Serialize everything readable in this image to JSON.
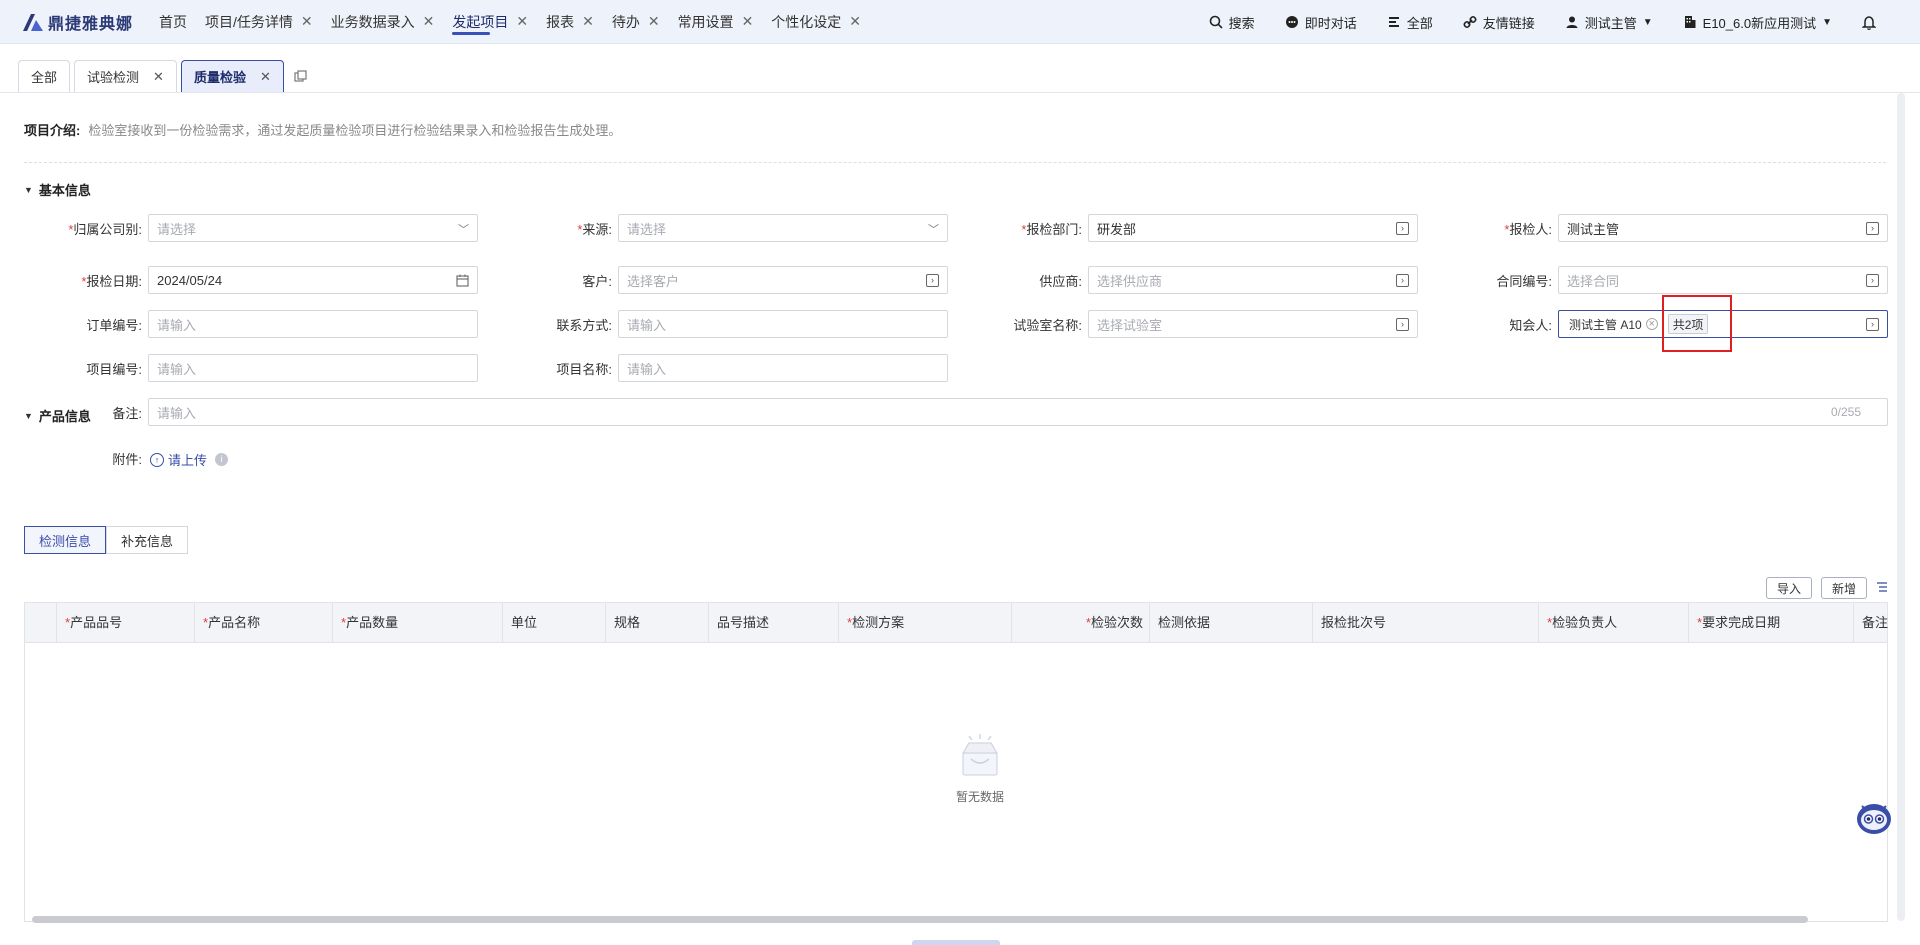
{
  "brand": {
    "name": "鼎捷雅典娜",
    "accent": "#3a4ea8"
  },
  "nav": {
    "items": [
      {
        "label": "首页",
        "closable": false
      },
      {
        "label": "项目/任务详情",
        "closable": true
      },
      {
        "label": "业务数据录入",
        "closable": true
      },
      {
        "label": "发起项目",
        "closable": true,
        "active": true
      },
      {
        "label": "报表",
        "closable": true
      },
      {
        "label": "待办",
        "closable": true
      },
      {
        "label": "常用设置",
        "closable": true
      },
      {
        "label": "个性化设定",
        "closable": true
      }
    ],
    "close_glyph": "✕"
  },
  "topright": {
    "search": "搜索",
    "chat": "即时对话",
    "all": "全部",
    "links": "友情链接",
    "user": "测试主管",
    "tenant": "E10_6.0新应用测试"
  },
  "tabs": {
    "all": "全部",
    "test": "试验检测",
    "quality": "质量检验"
  },
  "intro": {
    "label": "项目介绍:",
    "text": "检验室接收到一份检验需求，通过发起质量检验项目进行检验结果录入和检验报告生成处理。"
  },
  "sections": {
    "basic": "基本信息",
    "product": "产品信息"
  },
  "form": {
    "company": {
      "label": "归属公司别:",
      "placeholder": "请选择"
    },
    "source": {
      "label": "来源:",
      "placeholder": "请选择"
    },
    "dept": {
      "label": "报检部门:",
      "value": "研发部"
    },
    "inspector": {
      "label": "报检人:",
      "value": "测试主管"
    },
    "date": {
      "label": "报检日期:",
      "value": "2024/05/24"
    },
    "customer": {
      "label": "客户:",
      "placeholder": "选择客户"
    },
    "supplier": {
      "label": "供应商:",
      "placeholder": "选择供应商"
    },
    "contract": {
      "label": "合同编号:",
      "placeholder": "选择合同"
    },
    "order": {
      "label": "订单编号:",
      "placeholder": "请输入"
    },
    "contact": {
      "label": "联系方式:",
      "placeholder": "请输入"
    },
    "lab": {
      "label": "试验室名称:",
      "placeholder": "选择试验室"
    },
    "notify": {
      "label": "知会人:",
      "chip": "测试主管 A10",
      "count": "共2项"
    },
    "projno": {
      "label": "项目编号:",
      "placeholder": "请输入"
    },
    "projname": {
      "label": "项目名称:",
      "placeholder": "请输入"
    },
    "remark": {
      "label": "备注:",
      "placeholder": "请输入",
      "counter": "0/255"
    },
    "attach": {
      "label": "附件:",
      "upload": "请上传"
    }
  },
  "subtabs": {
    "detect": "检测信息",
    "extra": "补充信息"
  },
  "table": {
    "import": "导入",
    "add": "新增",
    "columns": [
      {
        "label": "产品品号",
        "req": true
      },
      {
        "label": "产品名称",
        "req": true
      },
      {
        "label": "产品数量",
        "req": true
      },
      {
        "label": "单位",
        "req": false
      },
      {
        "label": "规格",
        "req": false
      },
      {
        "label": "品号描述",
        "req": false
      },
      {
        "label": "检测方案",
        "req": true
      },
      {
        "label": "检验次数",
        "req": true
      },
      {
        "label": "检测依据",
        "req": false
      },
      {
        "label": "报检批次号",
        "req": false
      },
      {
        "label": "检验负责人",
        "req": true
      },
      {
        "label": "要求完成日期",
        "req": true
      },
      {
        "label": "备注",
        "req": false
      }
    ],
    "empty": "暂无数据"
  }
}
